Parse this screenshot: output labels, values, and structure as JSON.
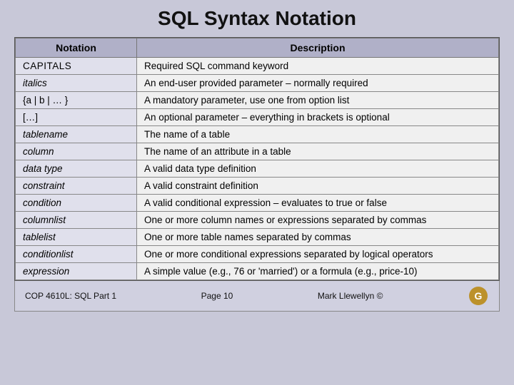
{
  "title": "SQL Syntax Notation",
  "table": {
    "headers": [
      "Notation",
      "Description"
    ],
    "rows": [
      {
        "notation": "CAPITALS",
        "notation_class": "notation-capitals",
        "description": "Required SQL command keyword"
      },
      {
        "notation": "italics",
        "notation_class": "notation-italics",
        "description": "An end-user provided parameter – normally required"
      },
      {
        "notation": "{a | b | … }",
        "notation_class": "notation-braces",
        "description": "A mandatory parameter, use one from option list"
      },
      {
        "notation": "[…]",
        "notation_class": "notation-brackets",
        "description": "An optional parameter – everything in brackets is optional"
      },
      {
        "notation": "tablename",
        "notation_class": "notation-tablename",
        "description": "The name of a table"
      },
      {
        "notation": "column",
        "notation_class": "notation-column",
        "description": "The name of an attribute in a table"
      },
      {
        "notation": "data type",
        "notation_class": "notation-datatype",
        "description": "A valid data type definition"
      },
      {
        "notation": "constraint",
        "notation_class": "notation-constraint",
        "description": "A valid constraint definition"
      },
      {
        "notation": "condition",
        "notation_class": "notation-condition",
        "description": "A valid conditional expression – evaluates to true or false"
      },
      {
        "notation": "columnlist",
        "notation_class": "notation-columnlist",
        "description": "One or more column names or expressions separated by commas"
      },
      {
        "notation": "tablelist",
        "notation_class": "notation-tablelist",
        "description": "One or more table names separated by commas"
      },
      {
        "notation": "conditionlist",
        "notation_class": "notation-conditionlist",
        "description": "One or more conditional expressions separated by logical operators"
      },
      {
        "notation": "expression",
        "notation_class": "notation-expression",
        "description": "A simple value (e.g., 76 or 'married') or a formula (e.g., price-10)"
      }
    ]
  },
  "footer": {
    "left": "COP 4610L: SQL Part 1",
    "center": "Page 10",
    "right": "Mark Llewellyn ©"
  }
}
